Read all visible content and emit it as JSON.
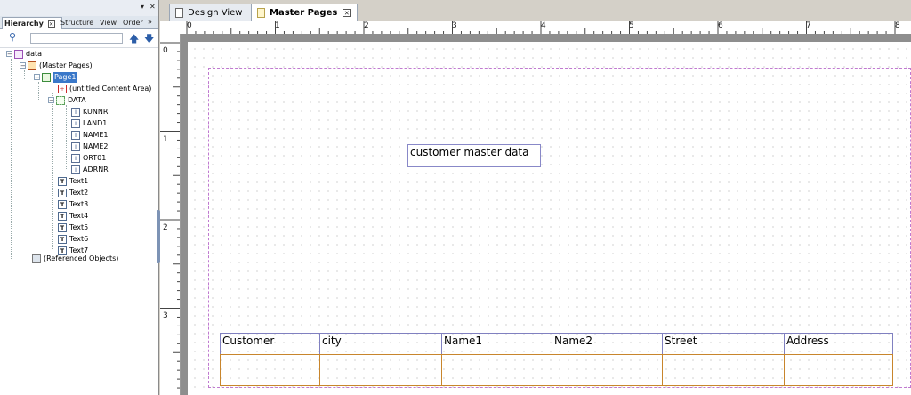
{
  "left_panel": {
    "tabs": [
      "Hierarchy",
      "Structure",
      "View",
      "Order"
    ],
    "search_value": "",
    "tree": {
      "root": "data",
      "master_pages": "(Master Pages)",
      "page1": "Page1",
      "content_area": "(untitled Content Area)",
      "data_subform": "DATA",
      "fields": [
        "KUNNR",
        "LAND1",
        "NAME1",
        "NAME2",
        "ORT01",
        "ADRNR"
      ],
      "texts": [
        "Text1",
        "Text2",
        "Text3",
        "Text4",
        "Text5",
        "Text6",
        "Text7"
      ],
      "referenced": "(Referenced Objects)"
    }
  },
  "editor_tabs": [
    {
      "label": "Design View",
      "active": false
    },
    {
      "label": "Master Pages",
      "active": true
    }
  ],
  "ruler": {
    "h_labels": [
      "0",
      "1",
      "2",
      "3",
      "4",
      "5",
      "6",
      "7",
      "8"
    ],
    "v_labels": [
      "0",
      "1",
      "2",
      "3"
    ]
  },
  "canvas": {
    "title_text": "customer master data",
    "table_headers": [
      "Customer",
      "city",
      "Name1",
      "Name2",
      "Street",
      "Address"
    ]
  },
  "colors": {
    "selection": "#3a78c9",
    "content_area_border": "#c07ad0",
    "row_border": "#c8852c",
    "header_border": "#8080c0"
  }
}
